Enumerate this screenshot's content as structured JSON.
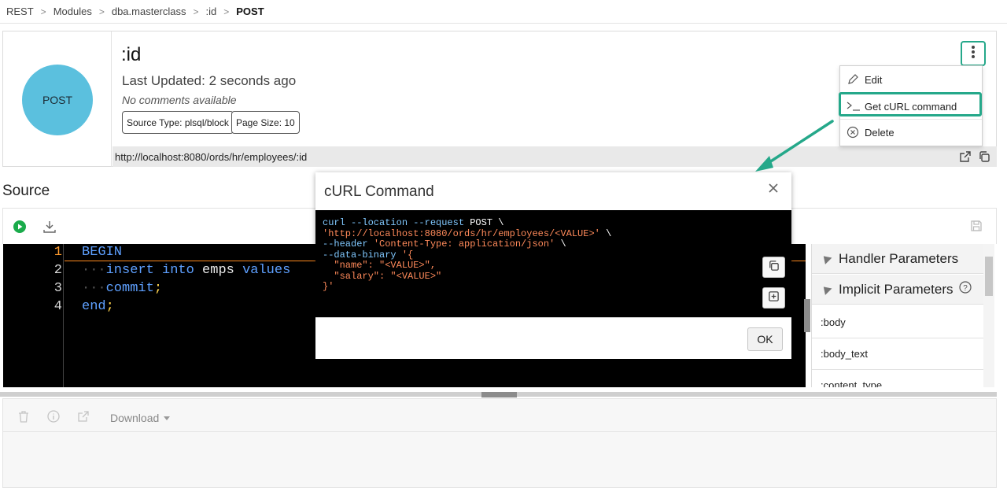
{
  "breadcrumb": {
    "items": [
      "REST",
      "Modules",
      "dba.masterclass",
      ":id",
      "POST"
    ],
    "separator": ">"
  },
  "card": {
    "avatar_label": "POST",
    "title": ":id",
    "last_updated": "Last Updated: 2 seconds ago",
    "comments": "No comments available",
    "source_type": "Source Type: plsql/block",
    "page_size": "Page Size: 10",
    "url": "http://localhost:8080/ords/hr/employees/:id"
  },
  "menu": {
    "items": [
      {
        "label": "Edit",
        "icon": "pencil-icon"
      },
      {
        "label": "Get cURL command",
        "icon": "terminal-icon"
      },
      {
        "label": "Delete",
        "icon": "circle-x-icon"
      }
    ]
  },
  "source": {
    "title": "Source",
    "line_numbers": [
      "1",
      "2",
      "3",
      "4"
    ],
    "code": {
      "l1": "BEGIN",
      "l2_kw1": "insert",
      "l2_kw2": "into",
      "l2_text": "emps",
      "l2_kw3": "values",
      "l3_kw": "commit",
      "l4_kw": "end",
      "semicolon": ";",
      "indent": "···"
    }
  },
  "params": {
    "handler_title": "Handler Parameters",
    "implicit_title": "Implicit Parameters",
    "items": [
      ":body",
      ":body_text",
      ":content_type"
    ]
  },
  "bottom": {
    "download_label": "Download"
  },
  "modal": {
    "title": "cURL Command",
    "ok_label": "OK",
    "curl": {
      "l1_cmd": "curl --location --request",
      "l1_method": "POST",
      "l1_cont": "\\",
      "l2_url": "'http://localhost:8080/ords/hr/employees/<VALUE>'",
      "l2_cont": "\\",
      "l3_cmd": "--header",
      "l3_val": "'Content-Type: application/json'",
      "l3_cont": "\\",
      "l4_cmd": "--data-binary",
      "l4_val": "'{",
      "l5": "  \"name\": \"<VALUE>\",",
      "l6": "  \"salary\": \"<VALUE>\"",
      "l7": "}'"
    }
  },
  "colors": {
    "accent": "#25a88a",
    "avatar": "#5bc0de",
    "code_bg": "#000000",
    "keyword": "#5ea0ff",
    "string": "#ff8a5a",
    "active_line_number": "#ff9c2f"
  }
}
